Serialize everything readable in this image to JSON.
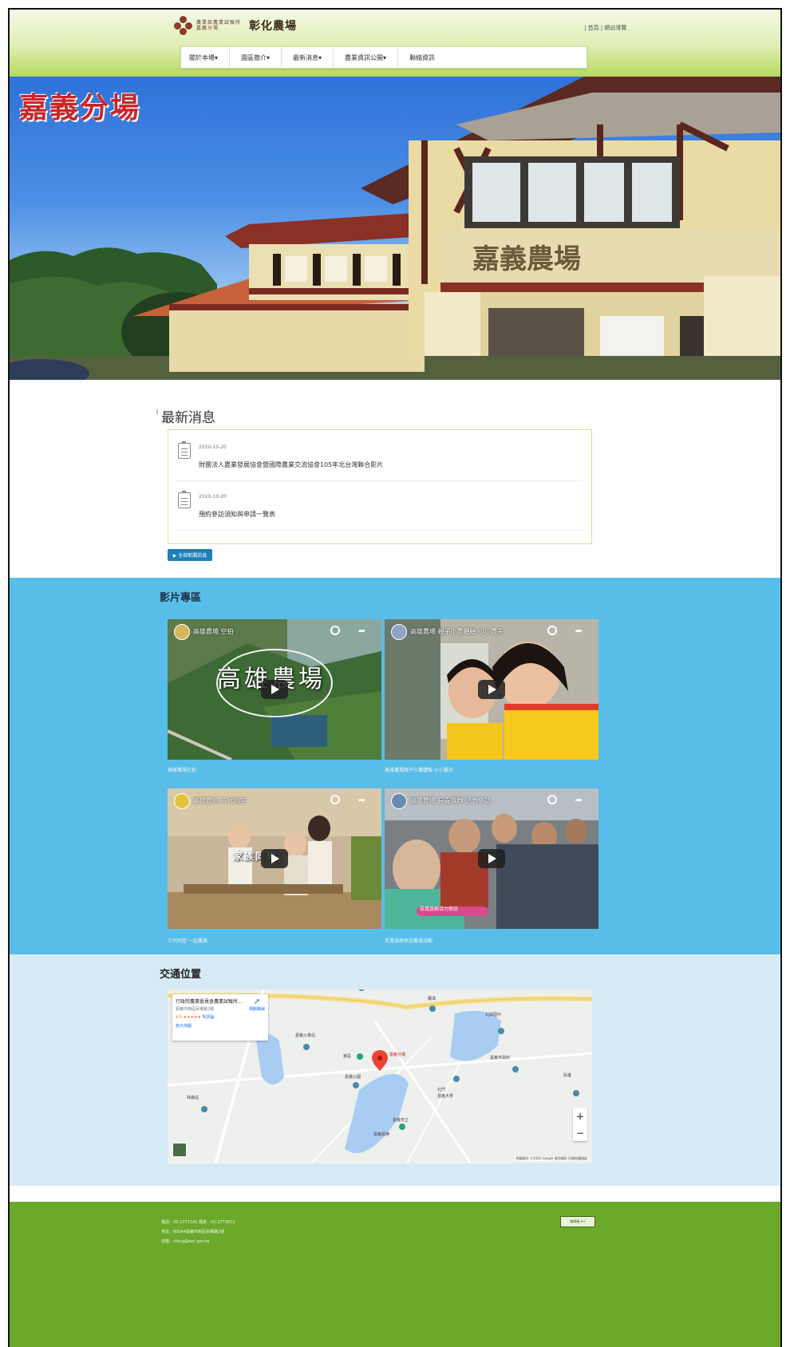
{
  "header": {
    "logo_subtitle": "農業部農業試驗所 嘉義分場",
    "logo_title": "彰化農場",
    "top_links": "| 首頁 | 網站導覽",
    "nav": [
      "關於本場▾",
      "園區簡介▾",
      "最新消息▾",
      "農業資訊公開▾",
      "聯絡資訊"
    ]
  },
  "hero": {
    "title": "嘉義分場"
  },
  "news": {
    "heading": "最新消息",
    "items": [
      {
        "date": "2020-10-20",
        "text": "財團法人農業發展協會暨國際農業交流協會105年北台灣聯合影片"
      },
      {
        "date": "2020-10-20",
        "text": "預約參訪須知與申請一覽表"
      }
    ],
    "more_label": "▶ 全部新聞訊息"
  },
  "videos": {
    "heading": "影片專區",
    "items": [
      {
        "title": "高雄農場 空拍",
        "overlay": "高雄農場",
        "caption": "高雄農場空拍"
      },
      {
        "title": "高雄農場 親子小農體驗 小小農夫",
        "overlay": "",
        "caption": "高雄農場親子小農體驗 小小農夫"
      },
      {
        "title": "高雄農場 三代同堂",
        "overlay": "家族同樂",
        "caption": "三代同堂 一起農場"
      },
      {
        "title": "高雄農場 長青族群 活力參訪",
        "overlay": "長青族群活力參訪",
        "caption": "長青族群參訪農場活動"
      }
    ]
  },
  "map": {
    "heading": "交通位置",
    "card_title": "行政院農業委員會農業試驗所...",
    "card_address": "嘉義市西區民權路2號",
    "card_rating": "4.5 ★★★★★",
    "card_reviews": "則評論",
    "card_link": "放大地圖",
    "directions": "規劃路線",
    "pin_label": "嘉義分場",
    "zoom_in": "+",
    "zoom_out": "−",
    "attribution": "地圖資料 ©2020 Google 使用條款 回報地圖錯誤",
    "labels": [
      "蘭潭",
      "北興國中",
      "嘉義火車站",
      "東區",
      "嘉義公園",
      "嘉義市政府",
      "民雄",
      "北門",
      "嘉義大學",
      "林森站",
      "嘉義市立",
      "嘉義長庚"
    ]
  },
  "footer": {
    "lines": [
      "電話：05-2771341 傳真：05-2773812",
      "地址：60044嘉義市西區民權路2號",
      "信箱：cfang@tari.gov.tw"
    ],
    "badge": "無障礙 A+"
  },
  "colors": {
    "header_green": "#b6d85c",
    "video_blue": "#58bde8",
    "map_bg": "#d6eaf6",
    "footer_green": "#6aa92a",
    "link_blue": "#1d7fb8",
    "hero_title_red": "#c9262a"
  }
}
